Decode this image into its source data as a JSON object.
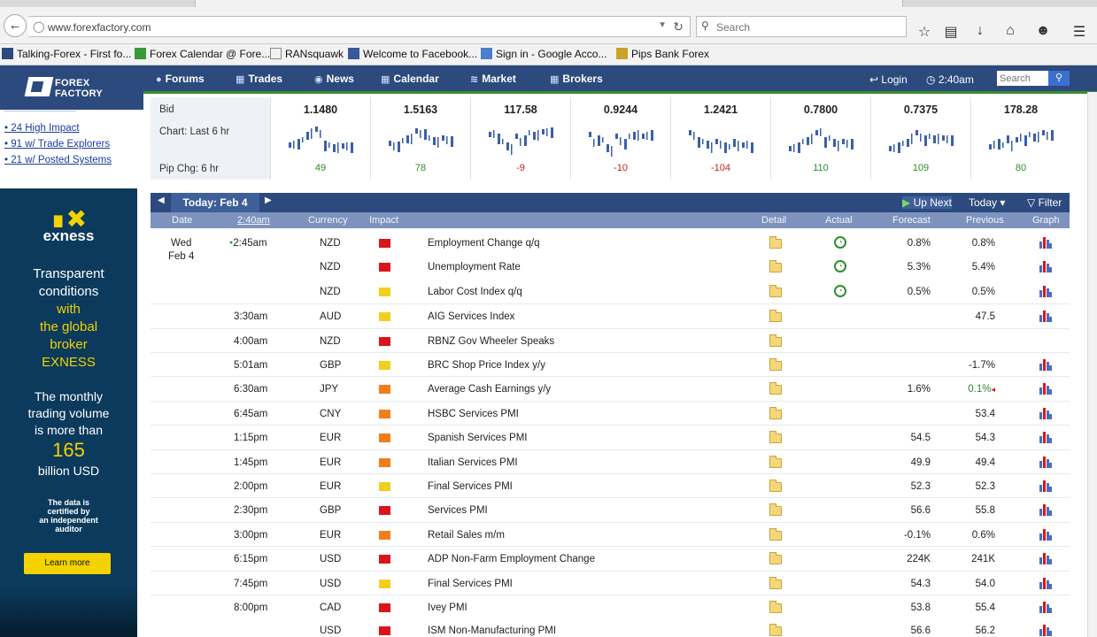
{
  "browser": {
    "url": "www.forexfactory.com",
    "search_placeholder": "Search",
    "bookmarks": [
      {
        "label": "Talking-Forex - First fo..."
      },
      {
        "label": "Forex Calendar @ Fore..."
      },
      {
        "label": "RANsquawk"
      },
      {
        "label": "Welcome to Facebook..."
      },
      {
        "label": "Sign in - Google Acco..."
      },
      {
        "label": "Pips Bank Forex"
      }
    ]
  },
  "header": {
    "logo_line1": "FOREX",
    "logo_line2": "FACTORY",
    "nav": [
      "Forums",
      "Trades",
      "News",
      "Calendar",
      "Market",
      "Brokers"
    ],
    "login": "Login",
    "time": "2:40am",
    "search_placeholder": "Search"
  },
  "sidebar": {
    "links": [
      "24 High Impact",
      "91 w/ Trade Explorers",
      "21 w/ Posted Systems"
    ]
  },
  "ad": {
    "brand": "exness",
    "lines": [
      "Transparent",
      "conditions",
      "with",
      "the global",
      "broker",
      "EXNESS"
    ],
    "line2": [
      "The monthly",
      "trading volume",
      "is more than"
    ],
    "big": "165",
    "unit": "billion USD",
    "small": [
      "The data is",
      "certified by",
      "an independent",
      "auditor"
    ],
    "cta": "Learn more"
  },
  "quotes": {
    "labels": {
      "bid": "Bid",
      "chart": "Chart: Last 6 hr",
      "pip": "Pip Chg: 6 hr"
    },
    "items": [
      {
        "bid": "1.1480",
        "pip": "49",
        "dir": "pos"
      },
      {
        "bid": "1.5163",
        "pip": "78",
        "dir": "pos"
      },
      {
        "bid": "117.58",
        "pip": "-9",
        "dir": "neg"
      },
      {
        "bid": "0.9244",
        "pip": "-10",
        "dir": "neg"
      },
      {
        "bid": "1.2421",
        "pip": "-104",
        "dir": "neg"
      },
      {
        "bid": "0.7800",
        "pip": "110",
        "dir": "pos"
      },
      {
        "bid": "0.7375",
        "pip": "109",
        "dir": "pos"
      },
      {
        "bid": "178.28",
        "pip": "80",
        "dir": "pos"
      }
    ]
  },
  "calendar": {
    "today_label": "Today: Feb 4",
    "up_next": "Up Next",
    "today_btn": "Today",
    "filter": "Filter",
    "columns": {
      "date": "Date",
      "time": "2:40am",
      "currency": "Currency",
      "impact": "Impact",
      "detail": "Detail",
      "actual": "Actual",
      "forecast": "Forecast",
      "previous": "Previous",
      "graph": "Graph"
    },
    "day": "Wed",
    "date": "Feb 4",
    "events": [
      {
        "time": "2:45am",
        "cur": "NZD",
        "impact": "red",
        "event": "Employment Change q/q",
        "actual": true,
        "forecast": "0.8%",
        "previous": "0.8%",
        "graph": true,
        "sep": false
      },
      {
        "time": "",
        "cur": "NZD",
        "impact": "red",
        "event": "Unemployment Rate",
        "actual": true,
        "forecast": "5.3%",
        "previous": "5.4%",
        "graph": true,
        "sep": false
      },
      {
        "time": "",
        "cur": "NZD",
        "impact": "yellow",
        "event": "Labor Cost Index q/q",
        "actual": true,
        "forecast": "0.5%",
        "previous": "0.5%",
        "graph": true,
        "sep": false
      },
      {
        "time": "3:30am",
        "cur": "AUD",
        "impact": "yellow",
        "event": "AIG Services Index",
        "actual": false,
        "forecast": "",
        "previous": "47.5",
        "graph": true,
        "sep": true
      },
      {
        "time": "4:00am",
        "cur": "NZD",
        "impact": "red",
        "event": "RBNZ Gov Wheeler Speaks",
        "actual": false,
        "forecast": "",
        "previous": "",
        "graph": false,
        "sep": true
      },
      {
        "time": "5:01am",
        "cur": "GBP",
        "impact": "yellow",
        "event": "BRC Shop Price Index y/y",
        "actual": false,
        "forecast": "",
        "previous": "-1.7%",
        "graph": true,
        "sep": true
      },
      {
        "time": "6:30am",
        "cur": "JPY",
        "impact": "orange",
        "event": "Average Cash Earnings y/y",
        "actual": false,
        "forecast": "1.6%",
        "previous": "0.1%",
        "prev_green": true,
        "graph": true,
        "sep": true
      },
      {
        "time": "6:45am",
        "cur": "CNY",
        "impact": "orange",
        "event": "HSBC Services PMI",
        "actual": false,
        "forecast": "",
        "previous": "53.4",
        "graph": true,
        "sep": true
      },
      {
        "time": "1:15pm",
        "cur": "EUR",
        "impact": "orange",
        "event": "Spanish Services PMI",
        "actual": false,
        "forecast": "54.5",
        "previous": "54.3",
        "graph": true,
        "sep": true
      },
      {
        "time": "1:45pm",
        "cur": "EUR",
        "impact": "orange",
        "event": "Italian Services PMI",
        "actual": false,
        "forecast": "49.9",
        "previous": "49.4",
        "graph": true,
        "sep": true
      },
      {
        "time": "2:00pm",
        "cur": "EUR",
        "impact": "yellow",
        "event": "Final Services PMI",
        "actual": false,
        "forecast": "52.3",
        "previous": "52.3",
        "graph": true,
        "sep": true
      },
      {
        "time": "2:30pm",
        "cur": "GBP",
        "impact": "red",
        "event": "Services PMI",
        "actual": false,
        "forecast": "56.6",
        "previous": "55.8",
        "graph": true,
        "sep": true
      },
      {
        "time": "3:00pm",
        "cur": "EUR",
        "impact": "orange",
        "event": "Retail Sales m/m",
        "actual": false,
        "forecast": "-0.1%",
        "previous": "0.6%",
        "graph": true,
        "sep": true
      },
      {
        "time": "6:15pm",
        "cur": "USD",
        "impact": "red",
        "event": "ADP Non-Farm Employment Change",
        "actual": false,
        "forecast": "224K",
        "previous": "241K",
        "graph": true,
        "sep": true
      },
      {
        "time": "7:45pm",
        "cur": "USD",
        "impact": "yellow",
        "event": "Final Services PMI",
        "actual": false,
        "forecast": "54.3",
        "previous": "54.0",
        "graph": true,
        "sep": true
      },
      {
        "time": "8:00pm",
        "cur": "CAD",
        "impact": "red",
        "event": "Ivey PMI",
        "actual": false,
        "forecast": "53.8",
        "previous": "55.4",
        "graph": true,
        "sep": true
      },
      {
        "time": "",
        "cur": "USD",
        "impact": "red",
        "event": "ISM Non-Manufacturing PMI",
        "actual": false,
        "forecast": "56.6",
        "previous": "56.2",
        "graph": true,
        "sep": false
      }
    ]
  }
}
